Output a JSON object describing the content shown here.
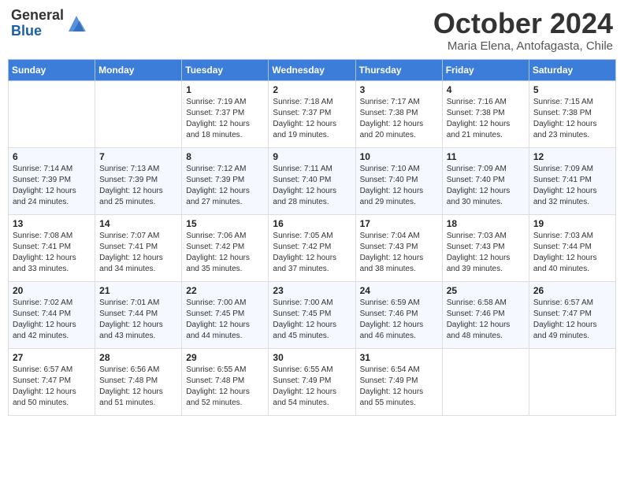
{
  "header": {
    "logo_general": "General",
    "logo_blue": "Blue",
    "month": "October 2024",
    "location": "Maria Elena, Antofagasta, Chile"
  },
  "days_of_week": [
    "Sunday",
    "Monday",
    "Tuesday",
    "Wednesday",
    "Thursday",
    "Friday",
    "Saturday"
  ],
  "weeks": [
    [
      {
        "day": "",
        "sunrise": "",
        "sunset": "",
        "daylight": ""
      },
      {
        "day": "",
        "sunrise": "",
        "sunset": "",
        "daylight": ""
      },
      {
        "day": "1",
        "sunrise": "Sunrise: 7:19 AM",
        "sunset": "Sunset: 7:37 PM",
        "daylight": "Daylight: 12 hours and 18 minutes."
      },
      {
        "day": "2",
        "sunrise": "Sunrise: 7:18 AM",
        "sunset": "Sunset: 7:37 PM",
        "daylight": "Daylight: 12 hours and 19 minutes."
      },
      {
        "day": "3",
        "sunrise": "Sunrise: 7:17 AM",
        "sunset": "Sunset: 7:38 PM",
        "daylight": "Daylight: 12 hours and 20 minutes."
      },
      {
        "day": "4",
        "sunrise": "Sunrise: 7:16 AM",
        "sunset": "Sunset: 7:38 PM",
        "daylight": "Daylight: 12 hours and 21 minutes."
      },
      {
        "day": "5",
        "sunrise": "Sunrise: 7:15 AM",
        "sunset": "Sunset: 7:38 PM",
        "daylight": "Daylight: 12 hours and 23 minutes."
      }
    ],
    [
      {
        "day": "6",
        "sunrise": "Sunrise: 7:14 AM",
        "sunset": "Sunset: 7:39 PM",
        "daylight": "Daylight: 12 hours and 24 minutes."
      },
      {
        "day": "7",
        "sunrise": "Sunrise: 7:13 AM",
        "sunset": "Sunset: 7:39 PM",
        "daylight": "Daylight: 12 hours and 25 minutes."
      },
      {
        "day": "8",
        "sunrise": "Sunrise: 7:12 AM",
        "sunset": "Sunset: 7:39 PM",
        "daylight": "Daylight: 12 hours and 27 minutes."
      },
      {
        "day": "9",
        "sunrise": "Sunrise: 7:11 AM",
        "sunset": "Sunset: 7:40 PM",
        "daylight": "Daylight: 12 hours and 28 minutes."
      },
      {
        "day": "10",
        "sunrise": "Sunrise: 7:10 AM",
        "sunset": "Sunset: 7:40 PM",
        "daylight": "Daylight: 12 hours and 29 minutes."
      },
      {
        "day": "11",
        "sunrise": "Sunrise: 7:09 AM",
        "sunset": "Sunset: 7:40 PM",
        "daylight": "Daylight: 12 hours and 30 minutes."
      },
      {
        "day": "12",
        "sunrise": "Sunrise: 7:09 AM",
        "sunset": "Sunset: 7:41 PM",
        "daylight": "Daylight: 12 hours and 32 minutes."
      }
    ],
    [
      {
        "day": "13",
        "sunrise": "Sunrise: 7:08 AM",
        "sunset": "Sunset: 7:41 PM",
        "daylight": "Daylight: 12 hours and 33 minutes."
      },
      {
        "day": "14",
        "sunrise": "Sunrise: 7:07 AM",
        "sunset": "Sunset: 7:41 PM",
        "daylight": "Daylight: 12 hours and 34 minutes."
      },
      {
        "day": "15",
        "sunrise": "Sunrise: 7:06 AM",
        "sunset": "Sunset: 7:42 PM",
        "daylight": "Daylight: 12 hours and 35 minutes."
      },
      {
        "day": "16",
        "sunrise": "Sunrise: 7:05 AM",
        "sunset": "Sunset: 7:42 PM",
        "daylight": "Daylight: 12 hours and 37 minutes."
      },
      {
        "day": "17",
        "sunrise": "Sunrise: 7:04 AM",
        "sunset": "Sunset: 7:43 PM",
        "daylight": "Daylight: 12 hours and 38 minutes."
      },
      {
        "day": "18",
        "sunrise": "Sunrise: 7:03 AM",
        "sunset": "Sunset: 7:43 PM",
        "daylight": "Daylight: 12 hours and 39 minutes."
      },
      {
        "day": "19",
        "sunrise": "Sunrise: 7:03 AM",
        "sunset": "Sunset: 7:44 PM",
        "daylight": "Daylight: 12 hours and 40 minutes."
      }
    ],
    [
      {
        "day": "20",
        "sunrise": "Sunrise: 7:02 AM",
        "sunset": "Sunset: 7:44 PM",
        "daylight": "Daylight: 12 hours and 42 minutes."
      },
      {
        "day": "21",
        "sunrise": "Sunrise: 7:01 AM",
        "sunset": "Sunset: 7:44 PM",
        "daylight": "Daylight: 12 hours and 43 minutes."
      },
      {
        "day": "22",
        "sunrise": "Sunrise: 7:00 AM",
        "sunset": "Sunset: 7:45 PM",
        "daylight": "Daylight: 12 hours and 44 minutes."
      },
      {
        "day": "23",
        "sunrise": "Sunrise: 7:00 AM",
        "sunset": "Sunset: 7:45 PM",
        "daylight": "Daylight: 12 hours and 45 minutes."
      },
      {
        "day": "24",
        "sunrise": "Sunrise: 6:59 AM",
        "sunset": "Sunset: 7:46 PM",
        "daylight": "Daylight: 12 hours and 46 minutes."
      },
      {
        "day": "25",
        "sunrise": "Sunrise: 6:58 AM",
        "sunset": "Sunset: 7:46 PM",
        "daylight": "Daylight: 12 hours and 48 minutes."
      },
      {
        "day": "26",
        "sunrise": "Sunrise: 6:57 AM",
        "sunset": "Sunset: 7:47 PM",
        "daylight": "Daylight: 12 hours and 49 minutes."
      }
    ],
    [
      {
        "day": "27",
        "sunrise": "Sunrise: 6:57 AM",
        "sunset": "Sunset: 7:47 PM",
        "daylight": "Daylight: 12 hours and 50 minutes."
      },
      {
        "day": "28",
        "sunrise": "Sunrise: 6:56 AM",
        "sunset": "Sunset: 7:48 PM",
        "daylight": "Daylight: 12 hours and 51 minutes."
      },
      {
        "day": "29",
        "sunrise": "Sunrise: 6:55 AM",
        "sunset": "Sunset: 7:48 PM",
        "daylight": "Daylight: 12 hours and 52 minutes."
      },
      {
        "day": "30",
        "sunrise": "Sunrise: 6:55 AM",
        "sunset": "Sunset: 7:49 PM",
        "daylight": "Daylight: 12 hours and 54 minutes."
      },
      {
        "day": "31",
        "sunrise": "Sunrise: 6:54 AM",
        "sunset": "Sunset: 7:49 PM",
        "daylight": "Daylight: 12 hours and 55 minutes."
      },
      {
        "day": "",
        "sunrise": "",
        "sunset": "",
        "daylight": ""
      },
      {
        "day": "",
        "sunrise": "",
        "sunset": "",
        "daylight": ""
      }
    ]
  ]
}
